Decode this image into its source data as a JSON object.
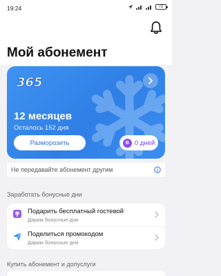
{
  "status_bar": {
    "time": "19:24",
    "battery": "72"
  },
  "page_title": "Мой абонемент",
  "subscription_card": {
    "logo_text": "365",
    "months": "12 месяцев",
    "remaining": "Осталось 152 дня",
    "unfreeze_label": "Разморозить",
    "freeze_days_badge": "B",
    "freeze_days_label": "0 дней",
    "accent_color": "#3f93f0"
  },
  "notice": "Не передавайте абонемент другим",
  "bonus_section": {
    "label": "Заработать бонусные дни",
    "items": [
      {
        "title": "Подарить бесплатный гостевой",
        "subtitle": "Дарим бонусные дни",
        "icon": "gift-icon"
      },
      {
        "title": "Поделиться промокодом",
        "subtitle": "Дарим бонусные дни",
        "icon": "send-icon"
      }
    ]
  },
  "buy_section": {
    "label": "Купить абонемент и допуслуги"
  }
}
